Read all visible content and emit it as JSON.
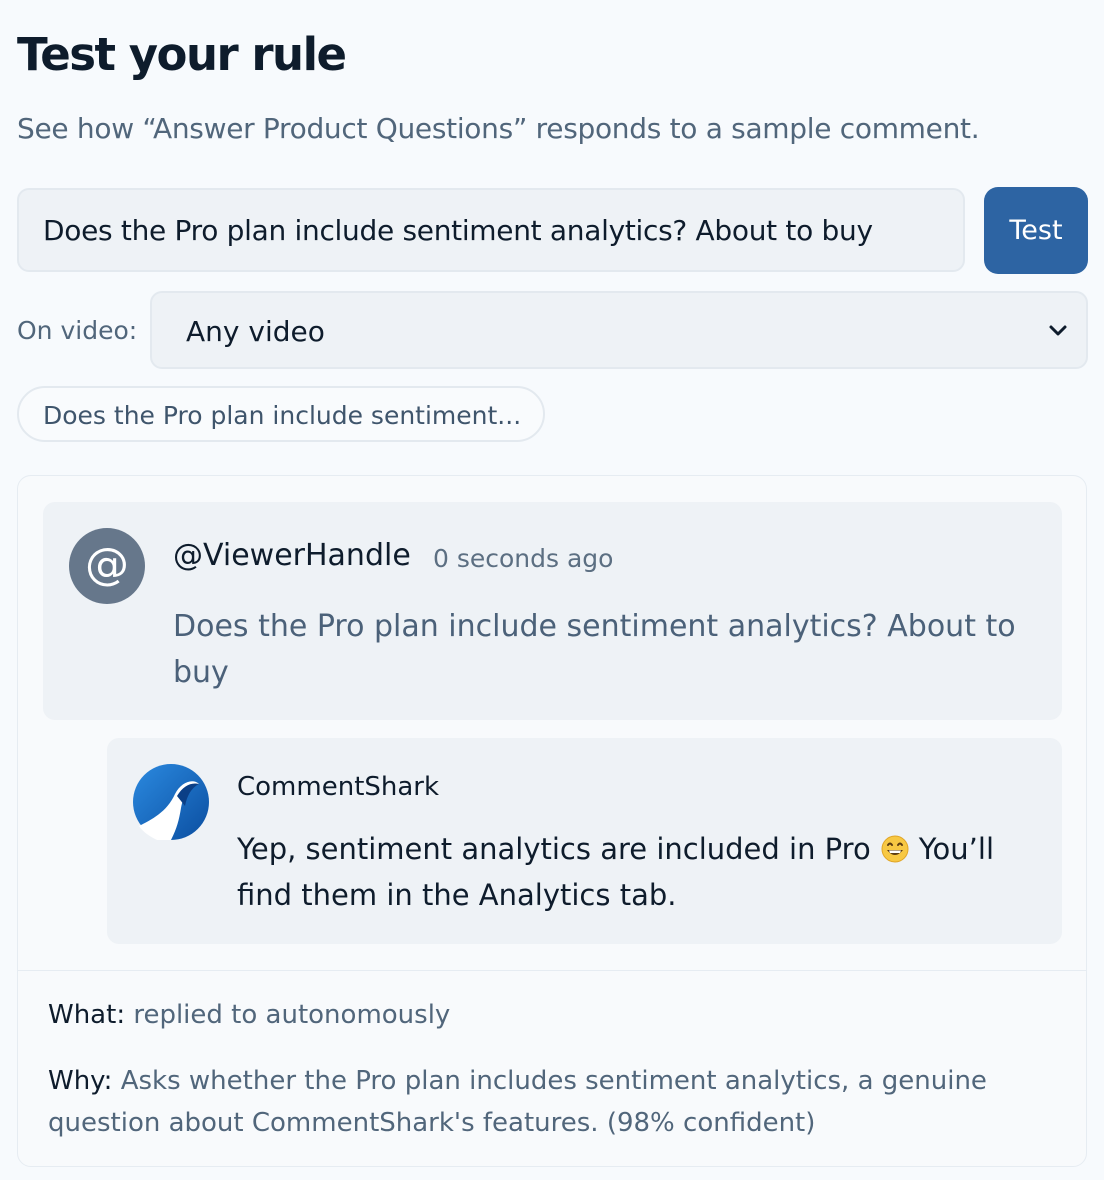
{
  "header": {
    "title": "Test your rule",
    "subtitle": "See how “Answer Product Questions” responds to a sample comment."
  },
  "tester": {
    "comment_value": "Does the Pro plan include sentiment analytics? About to buy",
    "test_label": "Test",
    "video_label": "On video:",
    "video_selected": "Any video",
    "sample_chip": "Does the Pro plan include sentiment..."
  },
  "preview": {
    "viewer": {
      "avatar_glyph": "@",
      "handle": "@ViewerHandle",
      "time": "0 seconds ago",
      "text": "Does the Pro plan include sentiment analytics? About to buy"
    },
    "reply": {
      "name": "CommentShark",
      "text_before": "Yep, sentiment analytics are included in Pro",
      "emoji_icon": "grinning-face-icon",
      "text_after": "You’ll find them in the Analytics tab.",
      "brand_color": "#1f6fc4"
    },
    "explanation": {
      "what_key": "What:",
      "what_value": "replied to autonomously",
      "why_key": "Why:",
      "why_value": "Asks whether the Pro plan includes sentiment analytics, a genuine question about CommentShark's features. (98% confident)"
    }
  },
  "colors": {
    "accent": "#2d64a3",
    "background": "#f7fafd",
    "panel": "#eef2f6"
  }
}
